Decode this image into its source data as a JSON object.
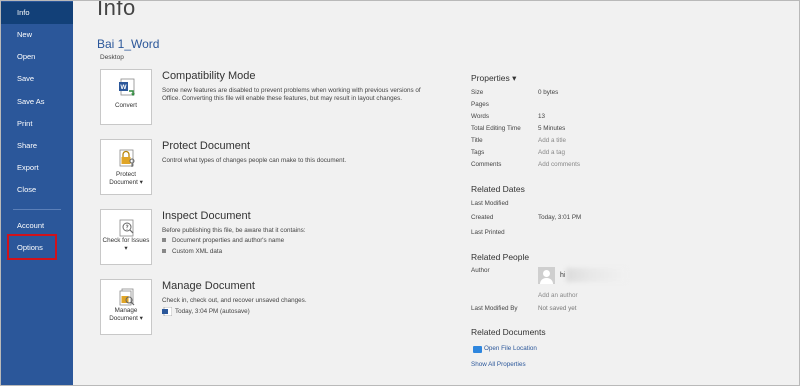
{
  "sidebar": {
    "items": [
      {
        "label": "Info"
      },
      {
        "label": "New"
      },
      {
        "label": "Open"
      },
      {
        "label": "Save"
      },
      {
        "label": "Save As"
      },
      {
        "label": "Print"
      },
      {
        "label": "Share"
      },
      {
        "label": "Export"
      },
      {
        "label": "Close"
      },
      {
        "label": "Account"
      },
      {
        "label": "Options"
      }
    ],
    "active": "Info",
    "highlight_color": "#d0121b",
    "bg_color": "#2b579a"
  },
  "page": {
    "title": "Info",
    "doc_name": "Bai 1_Word",
    "location": "Desktop"
  },
  "sections": [
    {
      "button_label": "Convert",
      "icon": "word-convert-icon",
      "title": "Compatibility Mode",
      "description": "Some new features are disabled to prevent problems when working with previous versions of Office. Converting this file will enable these features, but may result in layout changes."
    },
    {
      "button_label": "Protect Document ▾",
      "icon": "lock-key-icon",
      "title": "Protect Document",
      "description": "Control what types of changes people can make to this document."
    },
    {
      "button_label": "Check for Issues ▾",
      "icon": "inspect-document-icon",
      "title": "Inspect Document",
      "description": "Before publishing this file, be aware that it contains:",
      "bullets": [
        "Document properties and author's name",
        "Custom XML data"
      ]
    },
    {
      "button_label": "Manage Document ▾",
      "icon": "manage-document-icon",
      "title": "Manage Document",
      "description": "Check in, check out, and recover unsaved changes.",
      "version": "Today, 3:04 PM (autosave)"
    }
  ],
  "properties": {
    "title": "Properties ▾",
    "rows": [
      {
        "label": "Size",
        "value": "0 bytes",
        "placeholder": false
      },
      {
        "label": "Pages",
        "value": "",
        "placeholder": false
      },
      {
        "label": "Words",
        "value": "13",
        "placeholder": false
      },
      {
        "label": "Total Editing Time",
        "value": "5 Minutes",
        "placeholder": false
      },
      {
        "label": "Title",
        "value": "Add a title",
        "placeholder": true
      },
      {
        "label": "Tags",
        "value": "Add a tag",
        "placeholder": true
      },
      {
        "label": "Comments",
        "value": "Add comments",
        "placeholder": true
      }
    ]
  },
  "related_dates": {
    "title": "Related Dates",
    "rows": [
      {
        "label": "Last Modified",
        "value": ""
      },
      {
        "label": "Created",
        "value": "Today, 3:01 PM"
      },
      {
        "label": "Last Printed",
        "value": ""
      }
    ]
  },
  "related_people": {
    "title": "Related People",
    "author_label": "Author",
    "author_name": "hi",
    "add_author": "Add an author",
    "last_modified_by_label": "Last Modified By",
    "last_modified_by_value": "Not saved yet"
  },
  "related_documents": {
    "title": "Related Documents",
    "open_location": "Open File Location",
    "show_all": "Show All Properties"
  }
}
